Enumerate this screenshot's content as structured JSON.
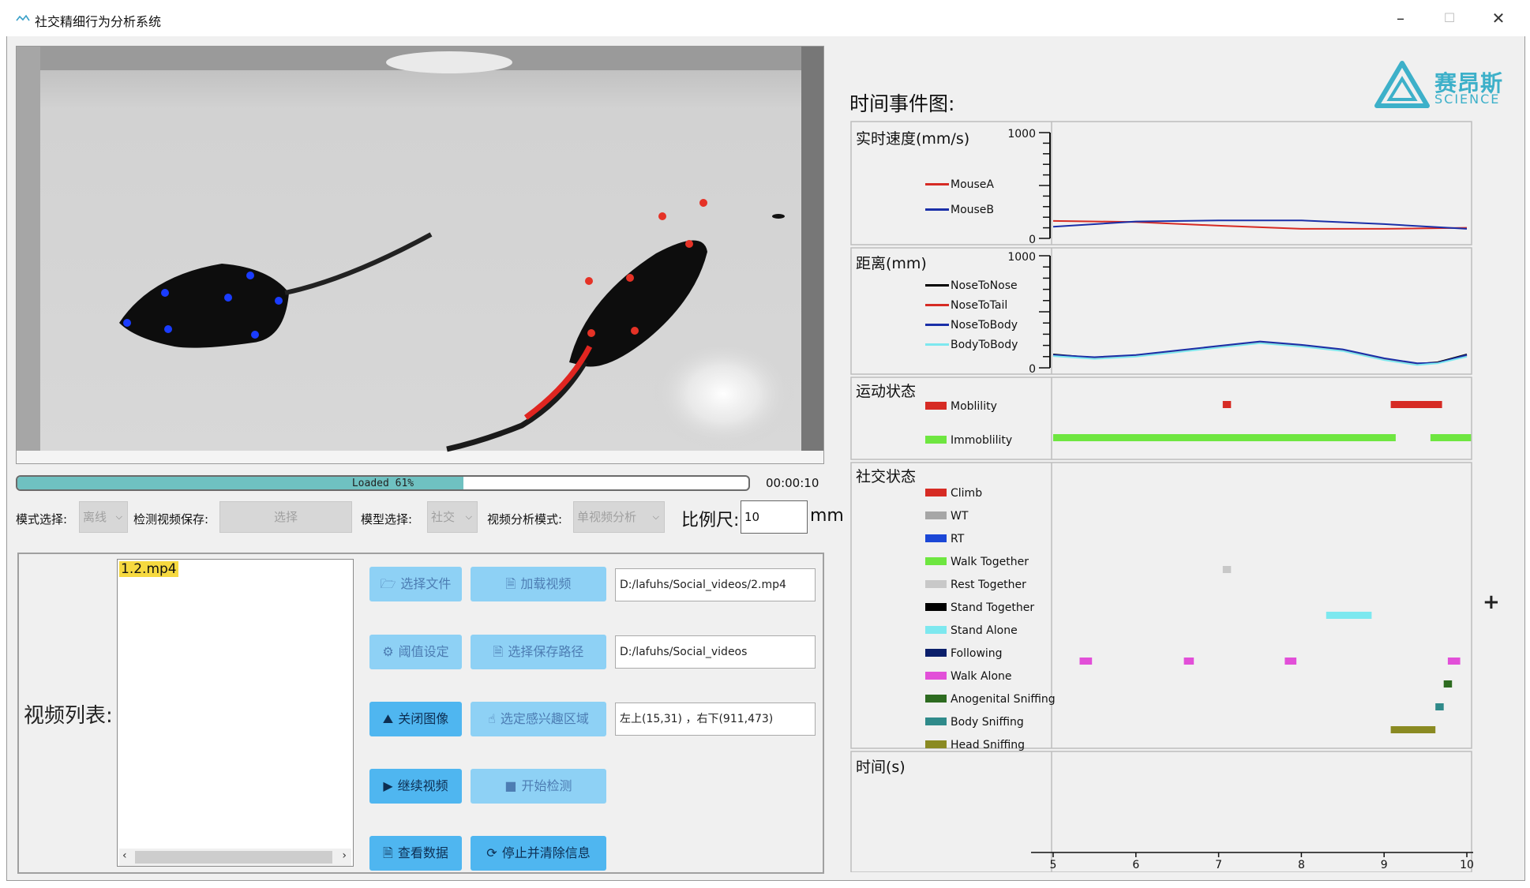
{
  "window": {
    "title": "社交精细行为分析系统",
    "minimize": "–",
    "maximize": "☐",
    "close": "✕"
  },
  "video": {
    "progress_percent": 61,
    "progress_text": "Loaded  61%",
    "time": "00:00:10"
  },
  "controls": {
    "mode_label": "模式选择:",
    "mode_value": "离线",
    "save_label": "检测视频保存:",
    "save_value": "选择",
    "model_label": "模型选择:",
    "model_value": "社交",
    "analysis_label": "视频分析模式:",
    "analysis_value": "单视频分析",
    "scale_label": "比例尺:",
    "scale_value": "10",
    "scale_unit": "mm"
  },
  "video_list": {
    "label": "视频列表:",
    "items": [
      "1.2.mp4"
    ]
  },
  "buttons": {
    "select_file": "选择文件",
    "load_video": "加载视频",
    "threshold": "阈值设定",
    "save_path": "选择保存路径",
    "close_image": "关闭图像",
    "select_roi": "选定感兴趣区域",
    "continue_video": "继续视频",
    "start_detect": "开始检测",
    "view_data": "查看数据",
    "stop_clear": "停止并清除信息"
  },
  "paths": {
    "video_path": "D:/lafuhs/Social_videos/2.mp4",
    "save_path": "D:/lafuhs/Social_videos",
    "roi": "左上(15,31) ，右下(911,473)"
  },
  "logo": {
    "cn": "赛昂斯",
    "en": "SCIENCE"
  },
  "chart_data": [
    {
      "type": "line",
      "title": "时间事件图:",
      "ylabel": "实时速度(mm/s)",
      "ylim": [
        0,
        1000
      ],
      "x": [
        5,
        6,
        7,
        8,
        9,
        10
      ],
      "series": [
        {
          "name": "MouseA",
          "color": "#d62b24",
          "values": [
            165,
            155,
            120,
            90,
            90,
            100
          ]
        },
        {
          "name": "MouseB",
          "color": "#1a2fa8",
          "values": [
            110,
            160,
            170,
            170,
            135,
            90
          ]
        }
      ]
    },
    {
      "type": "line",
      "ylabel": "距离(mm)",
      "ylim": [
        0,
        1000
      ],
      "x": [
        5,
        5.5,
        6,
        6.5,
        7,
        7.5,
        8,
        8.5,
        9,
        9.4,
        9.65,
        10
      ],
      "series": [
        {
          "name": "NoseToNose",
          "color": "#000000",
          "values": [
            120,
            90,
            110,
            150,
            190,
            230,
            200,
            160,
            80,
            35,
            50,
            120
          ]
        },
        {
          "name": "NoseToTail",
          "color": "#d62b24",
          "values": [
            110,
            85,
            105,
            145,
            185,
            225,
            195,
            155,
            75,
            30,
            45,
            110
          ]
        },
        {
          "name": "NoseToBody",
          "color": "#1a2fa8",
          "values": [
            115,
            95,
            115,
            155,
            195,
            235,
            205,
            165,
            85,
            40,
            45,
            115
          ]
        },
        {
          "name": "BodyToBody",
          "color": "#7de8ef",
          "values": [
            105,
            80,
            100,
            140,
            180,
            220,
            190,
            150,
            70,
            25,
            40,
            100
          ]
        }
      ]
    },
    {
      "type": "timeline",
      "ylabel": "运动状态",
      "xlim": [
        5,
        10
      ],
      "rows": [
        {
          "name": "Moblility",
          "color": "#d62b24",
          "segments": [
            [
              7.05,
              7.15
            ],
            [
              9.08,
              9.7
            ]
          ]
        },
        {
          "name": "Immoblility",
          "color": "#6ee640",
          "segments": [
            [
              5,
              9.14
            ],
            [
              9.56,
              10.05
            ]
          ]
        }
      ]
    },
    {
      "type": "timeline",
      "ylabel": "社交状态",
      "xlim": [
        5,
        10
      ],
      "rows": [
        {
          "name": "Climb",
          "color": "#d62b24",
          "segments": []
        },
        {
          "name": "WT",
          "color": "#a6a6a6",
          "segments": []
        },
        {
          "name": "RT",
          "color": "#1b47d6",
          "segments": []
        },
        {
          "name": "Walk Together",
          "color": "#6ee640",
          "segments": []
        },
        {
          "name": "Rest Together",
          "color": "#c8c8c8",
          "segments": [
            [
              7.05,
              7.15
            ]
          ]
        },
        {
          "name": "Stand Together",
          "color": "#000000",
          "segments": []
        },
        {
          "name": "Stand Alone",
          "color": "#7de8ef",
          "segments": [
            [
              8.3,
              8.85
            ]
          ]
        },
        {
          "name": "Following",
          "color": "#0b1f6b",
          "segments": []
        },
        {
          "name": "Walk Alone",
          "color": "#e24fd8",
          "segments": [
            [
              5.32,
              5.47
            ],
            [
              6.58,
              6.7
            ],
            [
              7.8,
              7.94
            ],
            [
              9.77,
              9.92
            ]
          ]
        },
        {
          "name": "Anogenital Sniffing",
          "color": "#2d6b20",
          "segments": [
            [
              9.72,
              9.82
            ]
          ]
        },
        {
          "name": "Body Sniffing",
          "color": "#2f8a8a",
          "segments": [
            [
              9.62,
              9.72
            ]
          ]
        },
        {
          "name": "Head Sniffing",
          "color": "#8a8a22",
          "segments": [
            [
              9.08,
              9.62
            ]
          ]
        }
      ]
    },
    {
      "type": "axis",
      "ylabel": "时间(s)",
      "xlim": [
        5,
        10
      ],
      "ticks": [
        "5",
        "6",
        "7",
        "8",
        "9",
        "10"
      ]
    }
  ]
}
